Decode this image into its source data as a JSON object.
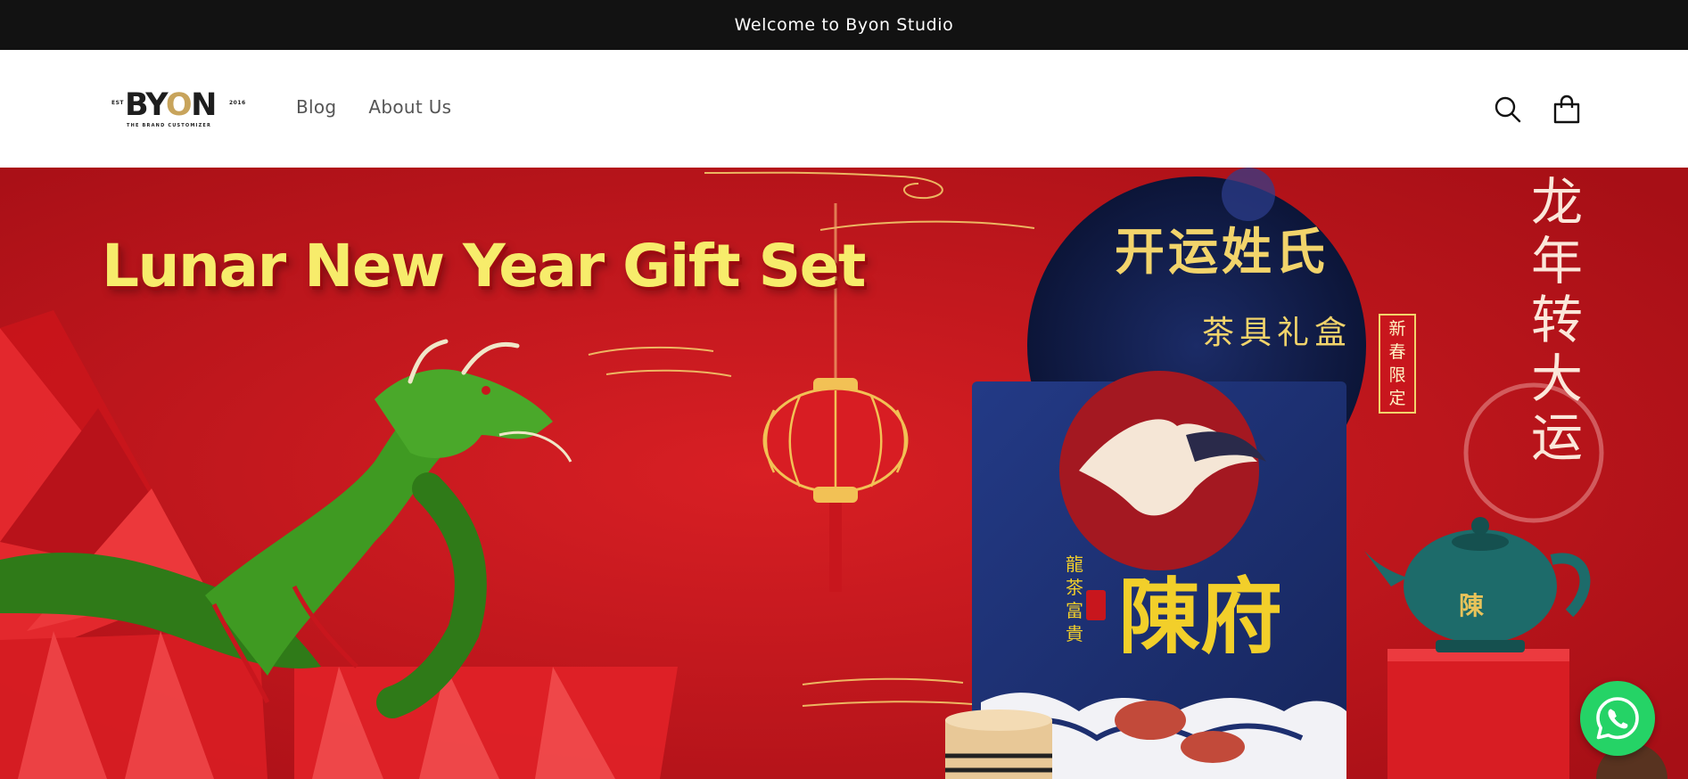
{
  "announcement": {
    "text": "Welcome to Byon Studio"
  },
  "header": {
    "logo": {
      "wordmark_left": "B",
      "wordmark_mid": "Y",
      "wordmark_o": "O",
      "wordmark_right": "N",
      "side_left": "EST",
      "side_right": "2016",
      "tagline": "THE BRAND CUSTOMIZER"
    },
    "nav": [
      {
        "label": "Blog"
      },
      {
        "label": "About Us"
      }
    ],
    "icons": {
      "search": "search-icon",
      "cart": "cart-icon"
    }
  },
  "hero": {
    "title": "Lunar New Year Gift Set",
    "cn_title": "开运姓氏",
    "cn_subtitle": "茶具礼盒",
    "cn_seal": "新春限定",
    "cn_vertical": "龙年转大运",
    "cn_brand": "陳府",
    "cn_brand_side": "龍茶富貴",
    "cn_pot": "陳",
    "colors": {
      "background": "#c8161d",
      "title": "#f7ec6b",
      "box": "#1d2f6f",
      "gold": "#f2d46b"
    }
  },
  "floating": {
    "whatsapp_icon": "whatsapp-icon"
  }
}
